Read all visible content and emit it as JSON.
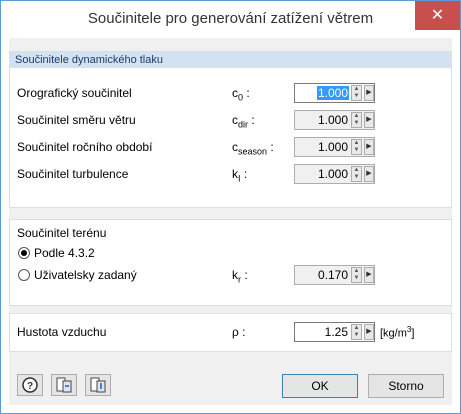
{
  "window": {
    "title": "Součinitele pro generování zatížení větrem",
    "close_glyph": "✕"
  },
  "dynamic_pressure": {
    "header": "Součinitele dynamického tlaku",
    "rows": [
      {
        "label": "Orografický součinitel",
        "symbol": "c",
        "sub": "0",
        "colon": " :",
        "value": "1.000"
      },
      {
        "label": "Součinitel směru větru",
        "symbol": "c",
        "sub": "dir",
        "colon": " :",
        "value": "1.000"
      },
      {
        "label": "Součinitel ročního období",
        "symbol": "c",
        "sub": "season",
        "colon": " :",
        "value": "1.000"
      },
      {
        "label": "Součinitel turbulence",
        "symbol": "k",
        "sub": "I",
        "colon": " :",
        "value": "1.000"
      }
    ]
  },
  "terrain": {
    "label": "Součinitel terénu",
    "option_standard": "Podle 4.3.2",
    "option_user": "Uživatelsky zadaný",
    "selected": "standard",
    "symbol": "k",
    "sub": "r",
    "colon": " :",
    "value": "0.170"
  },
  "air": {
    "label": "Hustota vzduchu",
    "symbol": "ρ :",
    "value": "1.25",
    "unit": "[kg/m",
    "unit_sup": "3",
    "unit_end": "]"
  },
  "footer": {
    "ok_label": "OK",
    "cancel_label": "Storno",
    "icons": [
      "help-icon",
      "import-icon",
      "export-icon"
    ]
  }
}
